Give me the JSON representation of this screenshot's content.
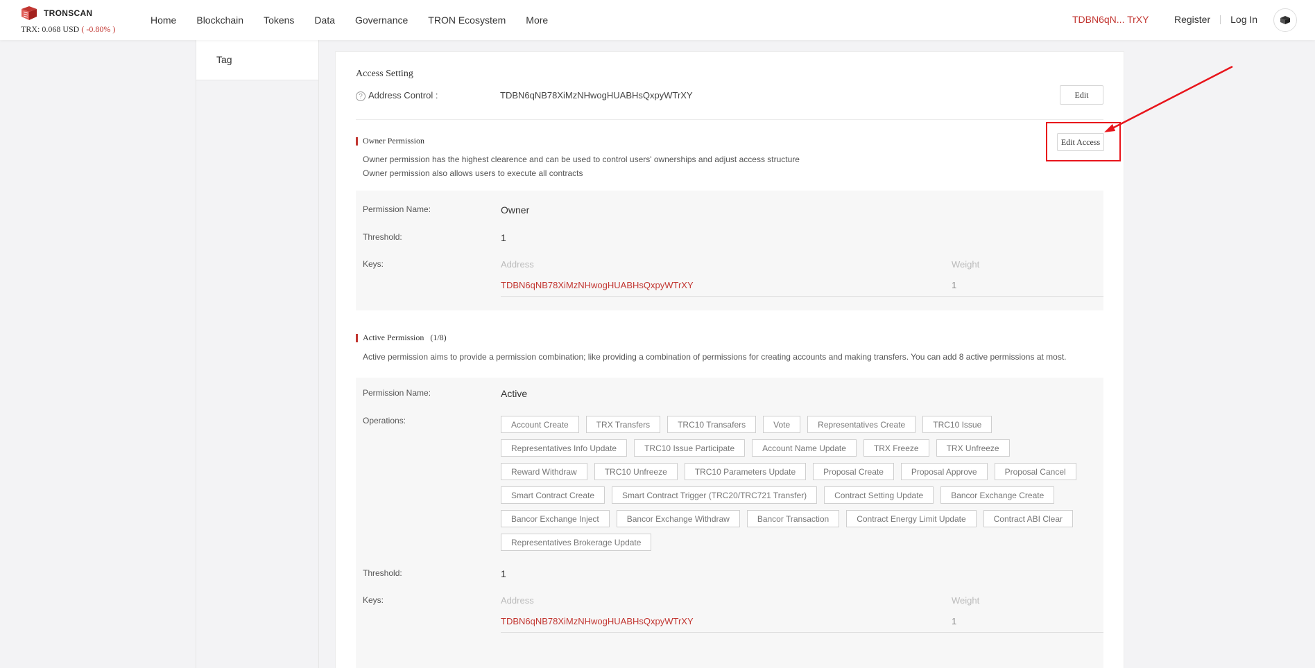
{
  "header": {
    "logo_text": "TRONSCAN",
    "price_label": "TRX: 0.068 USD",
    "price_change": "( -0.80% )",
    "nav": [
      "Home",
      "Blockchain",
      "Tokens",
      "Data",
      "Governance",
      "TRON Ecosystem",
      "More"
    ],
    "account_address": "TDBN6qN... TrXY",
    "register": "Register",
    "login": "Log In"
  },
  "sidebar": {
    "tag_label": "Tag"
  },
  "access": {
    "title": "Access Setting",
    "address_control_label": "Address Control :",
    "address_control_value": "TDBN6qNB78XiMzNHwogHUABHsQxpyWTrXY",
    "edit_label": "Edit"
  },
  "owner": {
    "title": "Owner Permission",
    "edit_access_label": "Edit Access",
    "desc1": "Owner permission has the highest clearence and can be used to control users' ownerships and adjust access structure",
    "desc2": "Owner permission also allows users to execute all contracts",
    "permission_name_label": "Permission Name:",
    "permission_name": "Owner",
    "threshold_label": "Threshold:",
    "threshold": "1",
    "keys_label": "Keys:",
    "address_header": "Address",
    "weight_header": "Weight",
    "key_address": "TDBN6qNB78XiMzNHwogHUABHsQxpyWTrXY",
    "key_weight": "1"
  },
  "active": {
    "title": "Active Permission",
    "count": "(1/8)",
    "desc": "Active permission aims to provide a permission combination; like providing a combination of permissions for creating accounts and making transfers. You can add 8 active permissions at most.",
    "permission_name_label": "Permission Name:",
    "permission_name": "Active",
    "operations_label": "Operations:",
    "operations": [
      "Account Create",
      "TRX Transfers",
      "TRC10 Transafers",
      "Vote",
      "Representatives Create",
      "TRC10 Issue",
      "Representatives Info Update",
      "TRC10 Issue Participate",
      "Account Name Update",
      "TRX Freeze",
      "TRX Unfreeze",
      "Reward Withdraw",
      "TRC10 Unfreeze",
      "TRC10 Parameters Update",
      "Proposal Create",
      "Proposal Approve",
      "Proposal Cancel",
      "Smart Contract Create",
      "Smart Contract Trigger (TRC20/TRC721 Transfer)",
      "Contract Setting Update",
      "Bancor Exchange Create",
      "Bancor Exchange Inject",
      "Bancor Exchange Withdraw",
      "Bancor Transaction",
      "Contract Energy Limit Update",
      "Contract ABI Clear",
      "Representatives Brokerage Update"
    ],
    "threshold_label": "Threshold:",
    "threshold": "1",
    "keys_label": "Keys:",
    "address_header": "Address",
    "weight_header": "Weight",
    "key_address": "TDBN6qNB78XiMzNHwogHUABHsQxpyWTrXY",
    "key_weight": "1"
  },
  "colors": {
    "accent": "#c23631",
    "annotation": "#e8141b"
  }
}
